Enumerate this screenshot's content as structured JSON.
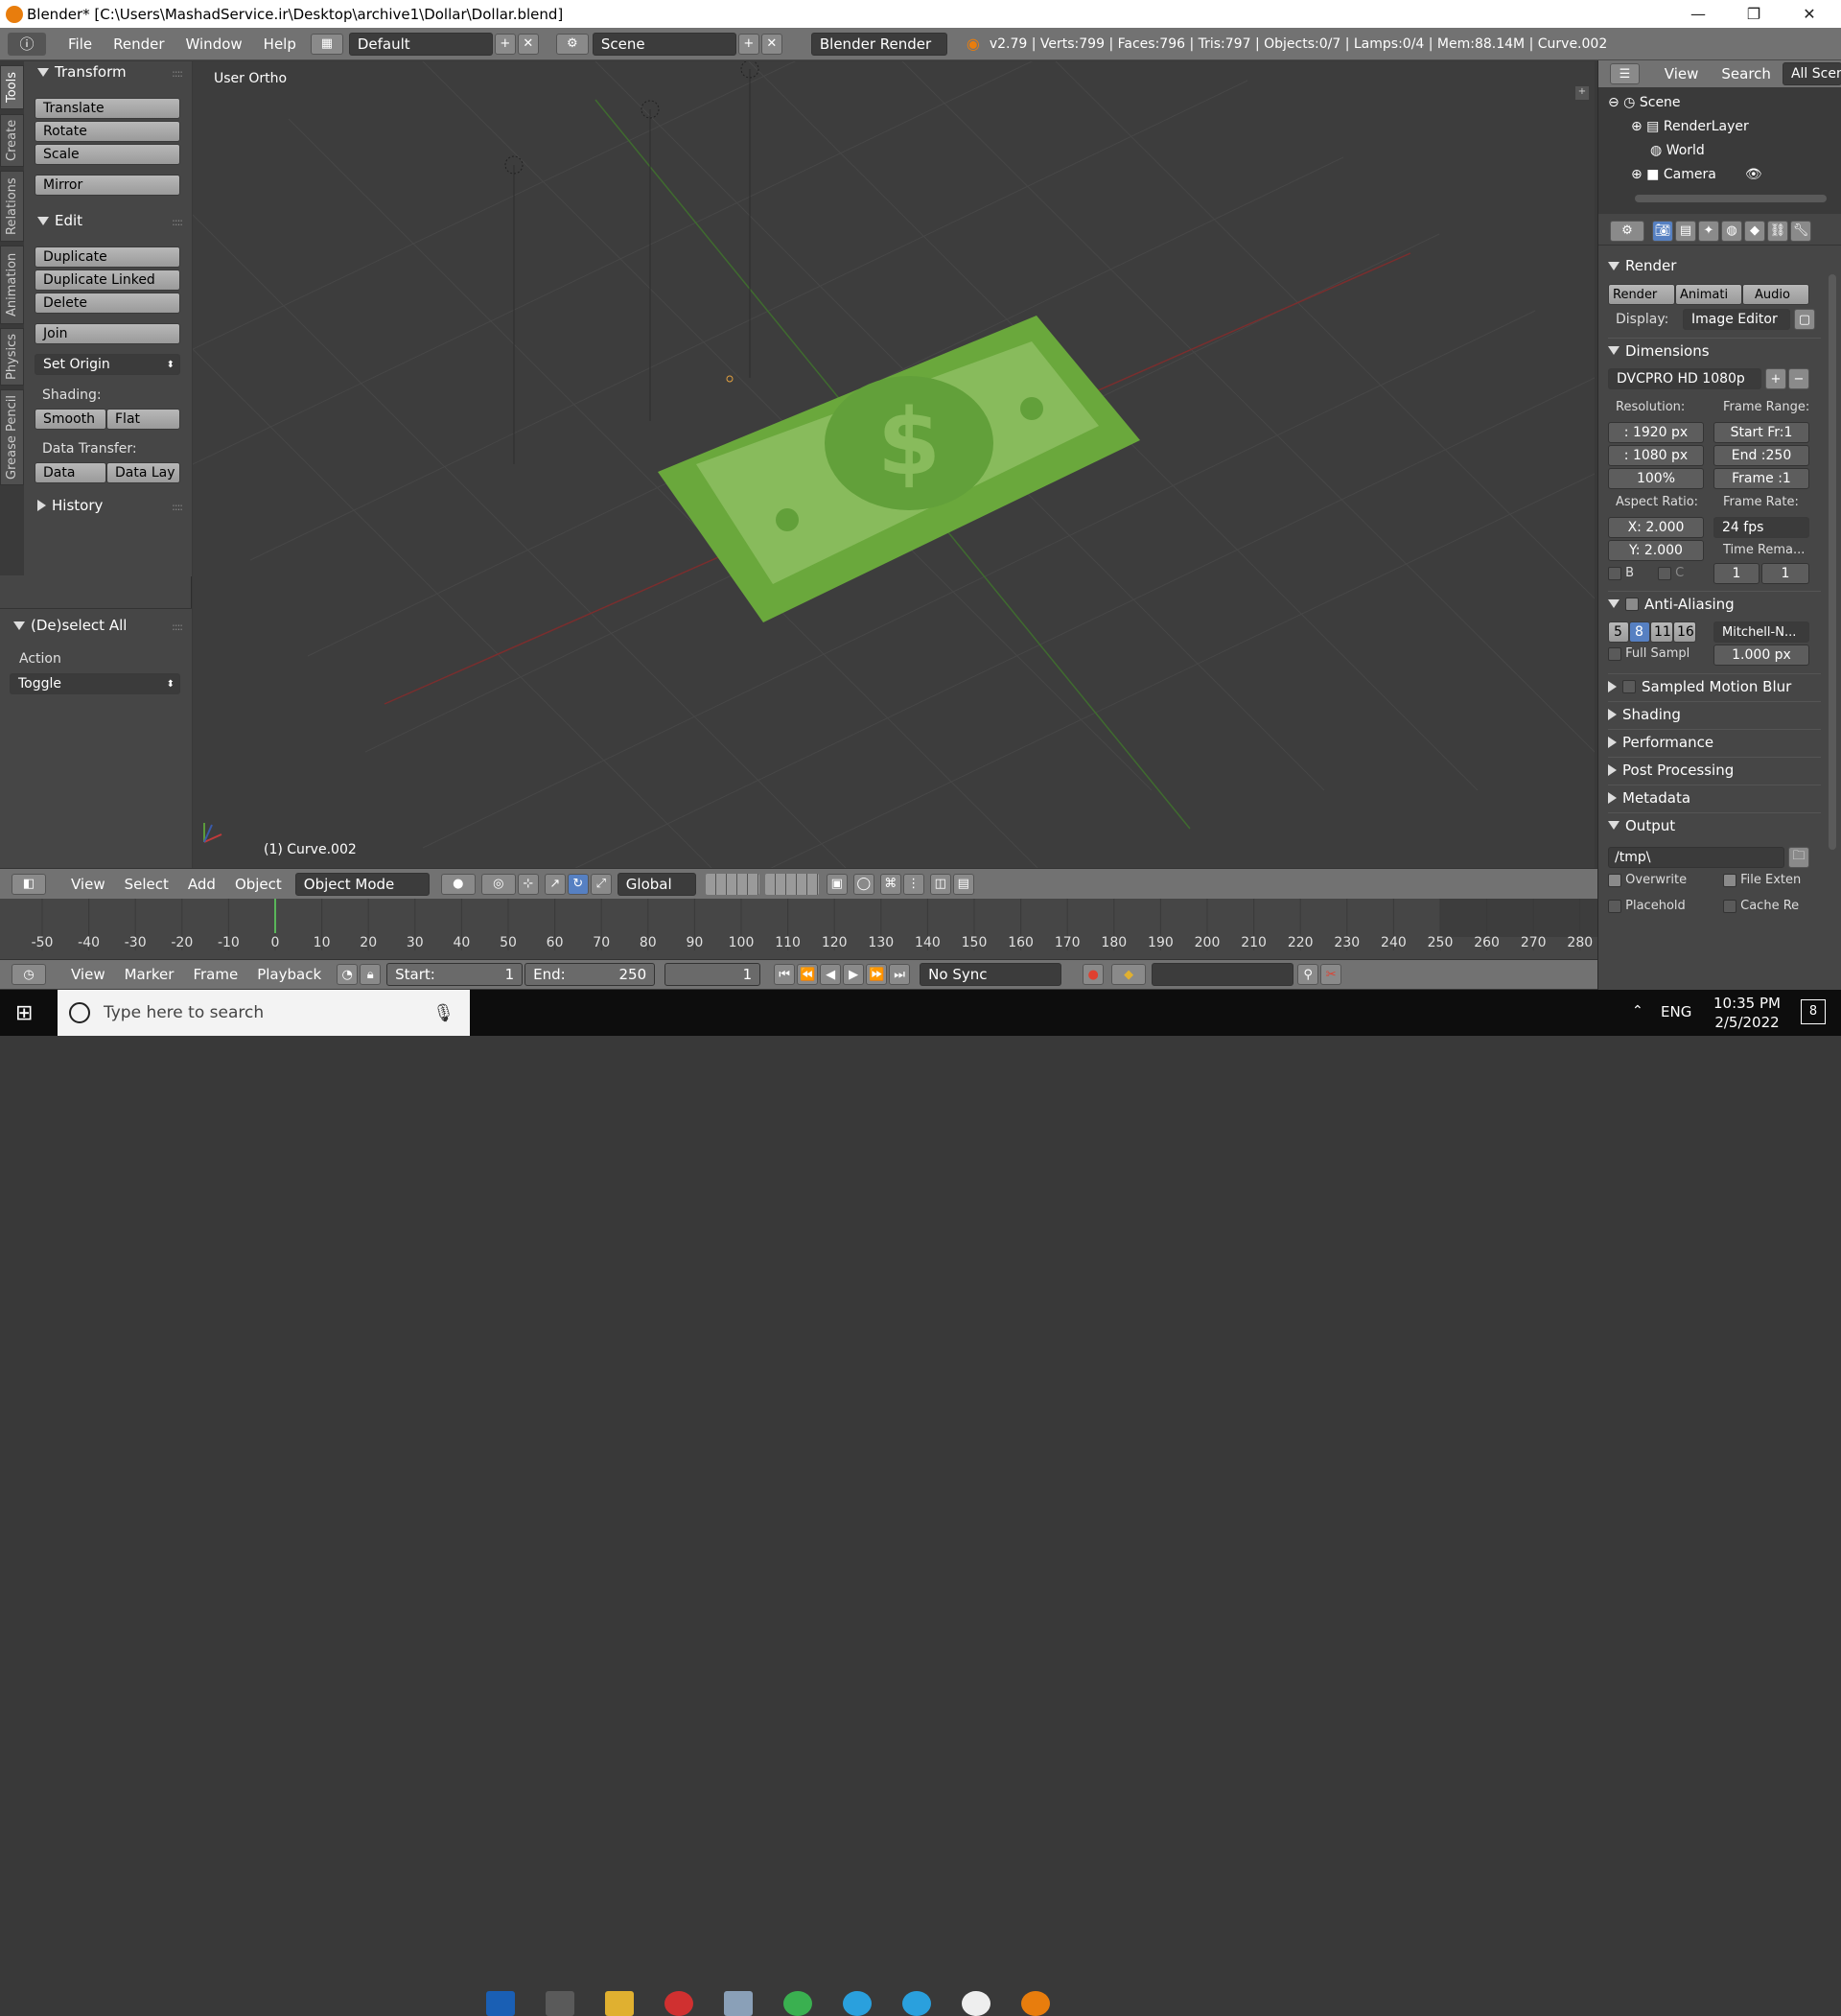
{
  "window": {
    "title": "Blender* [C:\\Users\\MashadService.ir\\Desktop\\archive1\\Dollar\\Dollar.blend]",
    "controls": [
      "—",
      "❐",
      "✕"
    ]
  },
  "topbar": {
    "menus": [
      "File",
      "Render",
      "Window",
      "Help"
    ],
    "screen_layout": "Default",
    "scene": "Scene",
    "engine": "Blender Render",
    "stats": "v2.79 | Verts:799 | Faces:796 | Tris:797 | Objects:0/7 | Lamps:0/4 | Mem:88.14M | Curve.002"
  },
  "tabs": [
    "Tools",
    "Create",
    "Relations",
    "Animation",
    "Physics",
    "Grease Pencil"
  ],
  "tool_panel": {
    "transform": {
      "title": "Transform",
      "buttons": [
        "Translate",
        "Rotate",
        "Scale",
        "Mirror"
      ]
    },
    "edit": {
      "title": "Edit",
      "buttons": [
        "Duplicate",
        "Duplicate Linked",
        "Delete",
        "Join"
      ],
      "set_origin": "Set Origin"
    },
    "shading": {
      "label": "Shading:",
      "smooth": "Smooth",
      "flat": "Flat"
    },
    "data_transfer": {
      "label": "Data Transfer:",
      "data": "Data",
      "data_lay": "Data Lay"
    },
    "history": "History"
  },
  "operator": {
    "title": "(De)select All",
    "action_label": "Action",
    "action_value": "Toggle"
  },
  "viewport": {
    "view_name": "User Ortho",
    "object_label": "(1) Curve.002"
  },
  "viewport_header": {
    "menus": [
      "View",
      "Select",
      "Add",
      "Object"
    ],
    "mode": "Object Mode",
    "orientation": "Global"
  },
  "timeline": {
    "ticks": [
      "-50",
      "-40",
      "-30",
      "-20",
      "-10",
      "0",
      "10",
      "20",
      "30",
      "40",
      "50",
      "60",
      "70",
      "80",
      "90",
      "100",
      "110",
      "120",
      "130",
      "140",
      "150",
      "160",
      "170",
      "180",
      "190",
      "200",
      "210",
      "220",
      "230",
      "240",
      "250",
      "260",
      "270",
      "280"
    ],
    "current_frame": 0,
    "menus": [
      "View",
      "Marker",
      "Frame",
      "Playback"
    ],
    "start_label": "Start:",
    "start_value": "1",
    "end_label": "End:",
    "end_value": "250",
    "frame_value": "1",
    "sync": "No Sync"
  },
  "outliner": {
    "menus": [
      "View",
      "Search",
      "All Scenes"
    ],
    "items": [
      "Scene",
      "RenderLayer",
      "World",
      "Camera"
    ]
  },
  "properties": {
    "render": {
      "title": "Render",
      "buttons": [
        "Render",
        "Animati",
        "Audio"
      ],
      "display_label": "Display:",
      "display_value": "Image Editor"
    },
    "dimensions": {
      "title": "Dimensions",
      "preset": "DVCPRO HD 1080p",
      "resolution_label": "Resolution:",
      "res_x": ": 1920 px",
      "res_y": ": 1080 px",
      "res_pct": "100%",
      "frame_range_label": "Frame Range:",
      "start": "Start Fr:1",
      "end": "End :250",
      "frame": "Frame :1",
      "aspect_label": "Aspect Ratio:",
      "aspect_x": "X:  2.000",
      "aspect_y": "Y:  2.000",
      "frame_rate_label": "Frame Rate:",
      "fps": "24 fps",
      "time_remap_label": "Time Rema...",
      "b_label": "B",
      "c_label": "C",
      "remap_old": "1",
      "remap_new": "1"
    },
    "antialiasing": {
      "title": "Anti-Aliasing",
      "samples": [
        "5",
        "8",
        "11",
        "16"
      ],
      "selected": "8",
      "filter": "Mitchell-N...",
      "full_sample": "Full Sampl",
      "size": "1.000 px"
    },
    "collapsed": [
      "Sampled Motion Blur",
      "Shading",
      "Performance",
      "Post Processing",
      "Metadata"
    ],
    "output": {
      "title": "Output",
      "path": "/tmp\\",
      "overwrite": "Overwrite",
      "file_ext": "File Exten",
      "placeholders": "Placehold",
      "cache": "Cache Re"
    }
  },
  "taskbar": {
    "search_placeholder": "Type here to search",
    "lang": "ENG",
    "time": "10:35 PM",
    "date": "2/5/2022",
    "notif_count": "8"
  }
}
